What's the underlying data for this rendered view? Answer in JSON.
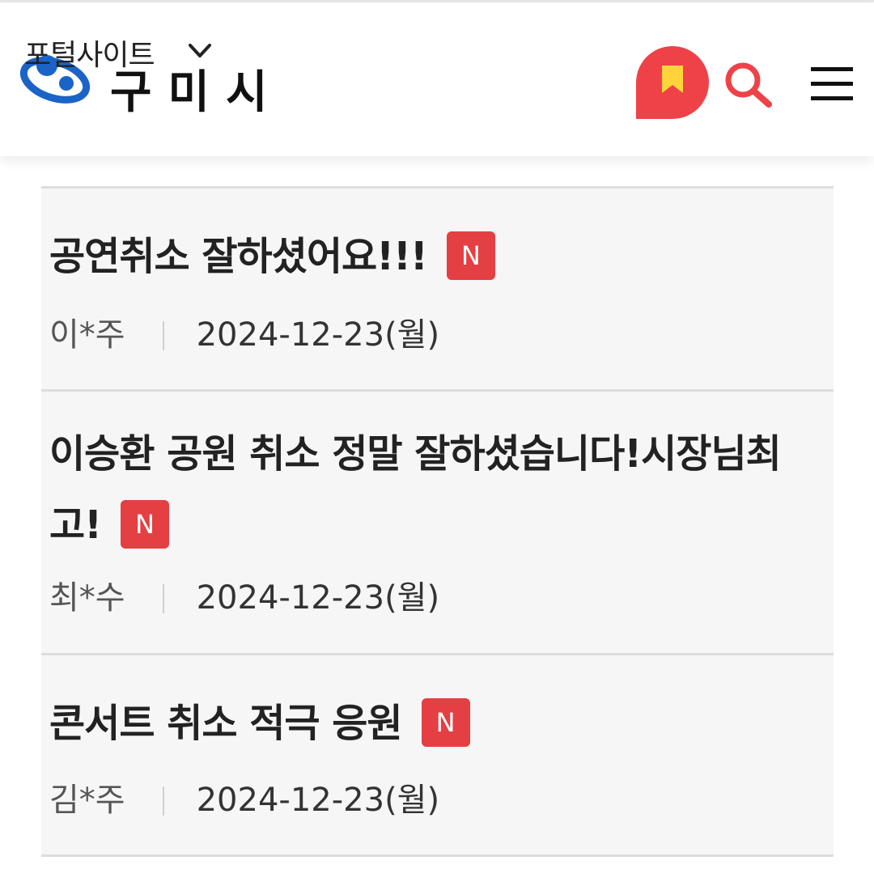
{
  "header": {
    "portal_label": "포털사이트",
    "city_name": "구미시",
    "logo_icon": "gumi-city-logo-icon",
    "dropdown_icon": "chevron-down-icon",
    "bookmark_icon": "bookmark-icon",
    "search_icon": "search-icon",
    "menu_icon": "hamburger-menu-icon",
    "accent_color": "#ee4248"
  },
  "posts": [
    {
      "title": "공연취소 잘하셨어요!!!",
      "badge": "N",
      "author": "이*주",
      "date": "2024-12-23(월)"
    },
    {
      "title": "이승환 공원 취소 정말 잘하셨습니다!시장님최고!",
      "badge": "N",
      "author": "최*수",
      "date": "2024-12-23(월)"
    },
    {
      "title": "콘서트 취소 적극 응원",
      "badge": "N",
      "author": "김*주",
      "date": "2024-12-23(월)"
    }
  ]
}
